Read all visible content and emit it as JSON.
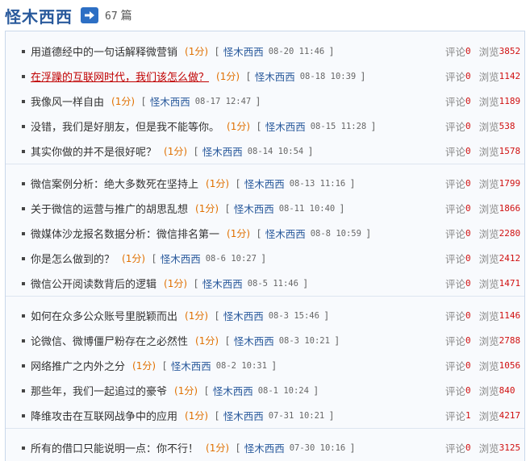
{
  "header": {
    "author_name": "怪木西西",
    "post_count": "67",
    "post_count_unit": "篇"
  },
  "labels": {
    "comments": "评论",
    "views": "浏览",
    "bracket_open": "[",
    "bracket_close": "]"
  },
  "posts": [
    {
      "title": "用道德经中的一句话解释微营销",
      "score": "(1分)",
      "author": "怪木西西",
      "date": "08-20 11:46",
      "comments": "0",
      "views": "3852"
    },
    {
      "title": "在浮躁的互联网时代，我们该怎么做？",
      "score": "(1分)",
      "author": "怪木西西",
      "date": "08-18 10:39",
      "comments": "0",
      "views": "1142",
      "highlighted": true
    },
    {
      "title": "我像风一样自由",
      "score": "(1分)",
      "author": "怪木西西",
      "date": "08-17 12:47",
      "comments": "0",
      "views": "1189"
    },
    {
      "title": "没错，我们是好朋友，但是我不能等你。",
      "score": "(1分)",
      "author": "怪木西西",
      "date": "08-15 11:28",
      "comments": "0",
      "views": "538"
    },
    {
      "title": "其实你做的并不是很好呢？",
      "score": "(1分)",
      "author": "怪木西西",
      "date": "08-14 10:54",
      "comments": "0",
      "views": "1578"
    },
    {
      "title": "微信案例分析：绝大多数死在坚持上",
      "score": "(1分)",
      "author": "怪木西西",
      "date": "08-13 11:16",
      "comments": "0",
      "views": "1799"
    },
    {
      "title": "关于微信的运营与推广的胡思乱想",
      "score": "(1分)",
      "author": "怪木西西",
      "date": "08-11 10:40",
      "comments": "0",
      "views": "1866"
    },
    {
      "title": "微媒体沙龙报名数据分析：微信排名第一",
      "score": "(1分)",
      "author": "怪木西西",
      "date": "08-8 10:59",
      "comments": "0",
      "views": "2280"
    },
    {
      "title": "你是怎么做到的？",
      "score": "(1分)",
      "author": "怪木西西",
      "date": "08-6 10:27",
      "comments": "0",
      "views": "2412"
    },
    {
      "title": "微信公开阅读数背后的逻辑",
      "score": "(1分)",
      "author": "怪木西西",
      "date": "08-5 11:46",
      "comments": "0",
      "views": "1471"
    },
    {
      "title": "如何在众多公众账号里脱颖而出",
      "score": "(1分)",
      "author": "怪木西西",
      "date": "08-3 15:46",
      "comments": "0",
      "views": "1146"
    },
    {
      "title": "论微信、微博僵尸粉存在之必然性",
      "score": "(1分)",
      "author": "怪木西西",
      "date": "08-3 10:21",
      "comments": "0",
      "views": "2788"
    },
    {
      "title": "网络推广之内外之分",
      "score": "(1分)",
      "author": "怪木西西",
      "date": "08-2 10:31",
      "comments": "0",
      "views": "1056"
    },
    {
      "title": "那些年，我们一起追过的豪爷",
      "score": "(1分)",
      "author": "怪木西西",
      "date": "08-1 10:24",
      "comments": "0",
      "views": "840"
    },
    {
      "title": "降维攻击在互联网战争中的应用",
      "score": "(1分)",
      "author": "怪木西西",
      "date": "07-31 10:21",
      "comments": "1",
      "views": "4217"
    },
    {
      "title": "所有的借口只能说明一点：你不行！",
      "score": "(1分)",
      "author": "怪木西西",
      "date": "07-30 10:16",
      "comments": "0",
      "views": "3125"
    }
  ],
  "colors": {
    "title_blue": "#2a5a9c",
    "highlight_red": "#c00000",
    "score_orange": "#e07000",
    "count_red": "#d01010",
    "panel_border": "#c9d7ea"
  }
}
